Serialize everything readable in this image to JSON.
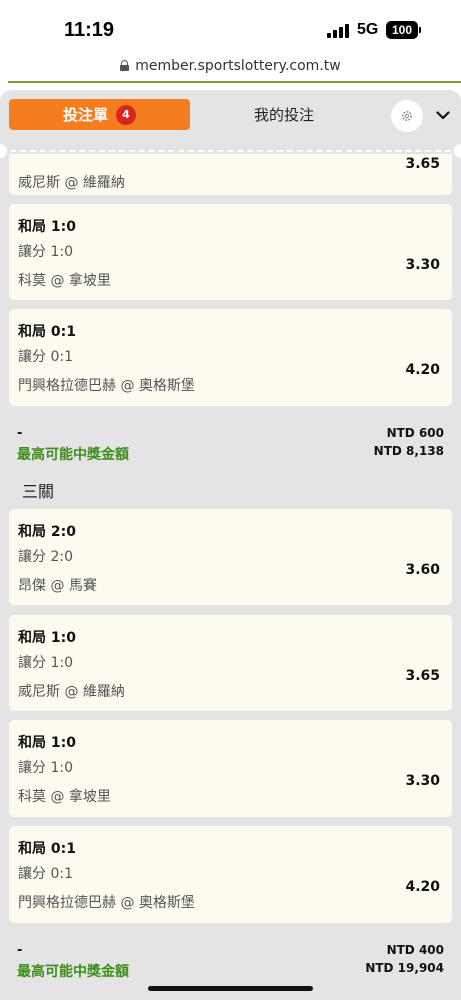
{
  "status_bar": {
    "time": "11:19",
    "network": "5G",
    "battery": "100"
  },
  "browser": {
    "url": "member.sportslottery.com.tw"
  },
  "tabs": {
    "betslip_label": "投注單",
    "betslip_count": "4",
    "mybets_label": "我的投注"
  },
  "colors": {
    "accent": "#f47d20",
    "badge": "#d9261c",
    "win_label": "#3e8e1c",
    "card_bg": "#fdfbf0"
  },
  "partial_card": {
    "match": "威尼斯 @ 維羅納",
    "odds": "3.65"
  },
  "group1": {
    "legs": [
      {
        "selection": "和局 1:0",
        "market": "讓分 1:0",
        "match": "科莫 @ 拿坡里",
        "odds": "3.30"
      },
      {
        "selection": "和局 0:1",
        "market": "讓分 0:1",
        "match": "門興格拉德巴赫 @ 奧格斯堡",
        "odds": "4.20"
      }
    ],
    "stake_dash": "-",
    "max_payout_label": "最高可能中獎金額",
    "stake": "NTD 600",
    "payout": "NTD 8,138"
  },
  "group2": {
    "title": "三關",
    "legs": [
      {
        "selection": "和局 2:0",
        "market": "讓分 2:0",
        "match": "昂傑 @ 馬賽",
        "odds": "3.60"
      },
      {
        "selection": "和局 1:0",
        "market": "讓分 1:0",
        "match": "威尼斯 @ 維羅納",
        "odds": "3.65"
      },
      {
        "selection": "和局 1:0",
        "market": "讓分 1:0",
        "match": "科莫 @ 拿坡里",
        "odds": "3.30"
      },
      {
        "selection": "和局 0:1",
        "market": "讓分 0:1",
        "match": "門興格拉德巴赫 @ 奧格斯堡",
        "odds": "4.20"
      }
    ],
    "stake_dash": "-",
    "max_payout_label": "最高可能中獎金額",
    "stake": "NTD 400",
    "payout": "NTD 19,904"
  }
}
